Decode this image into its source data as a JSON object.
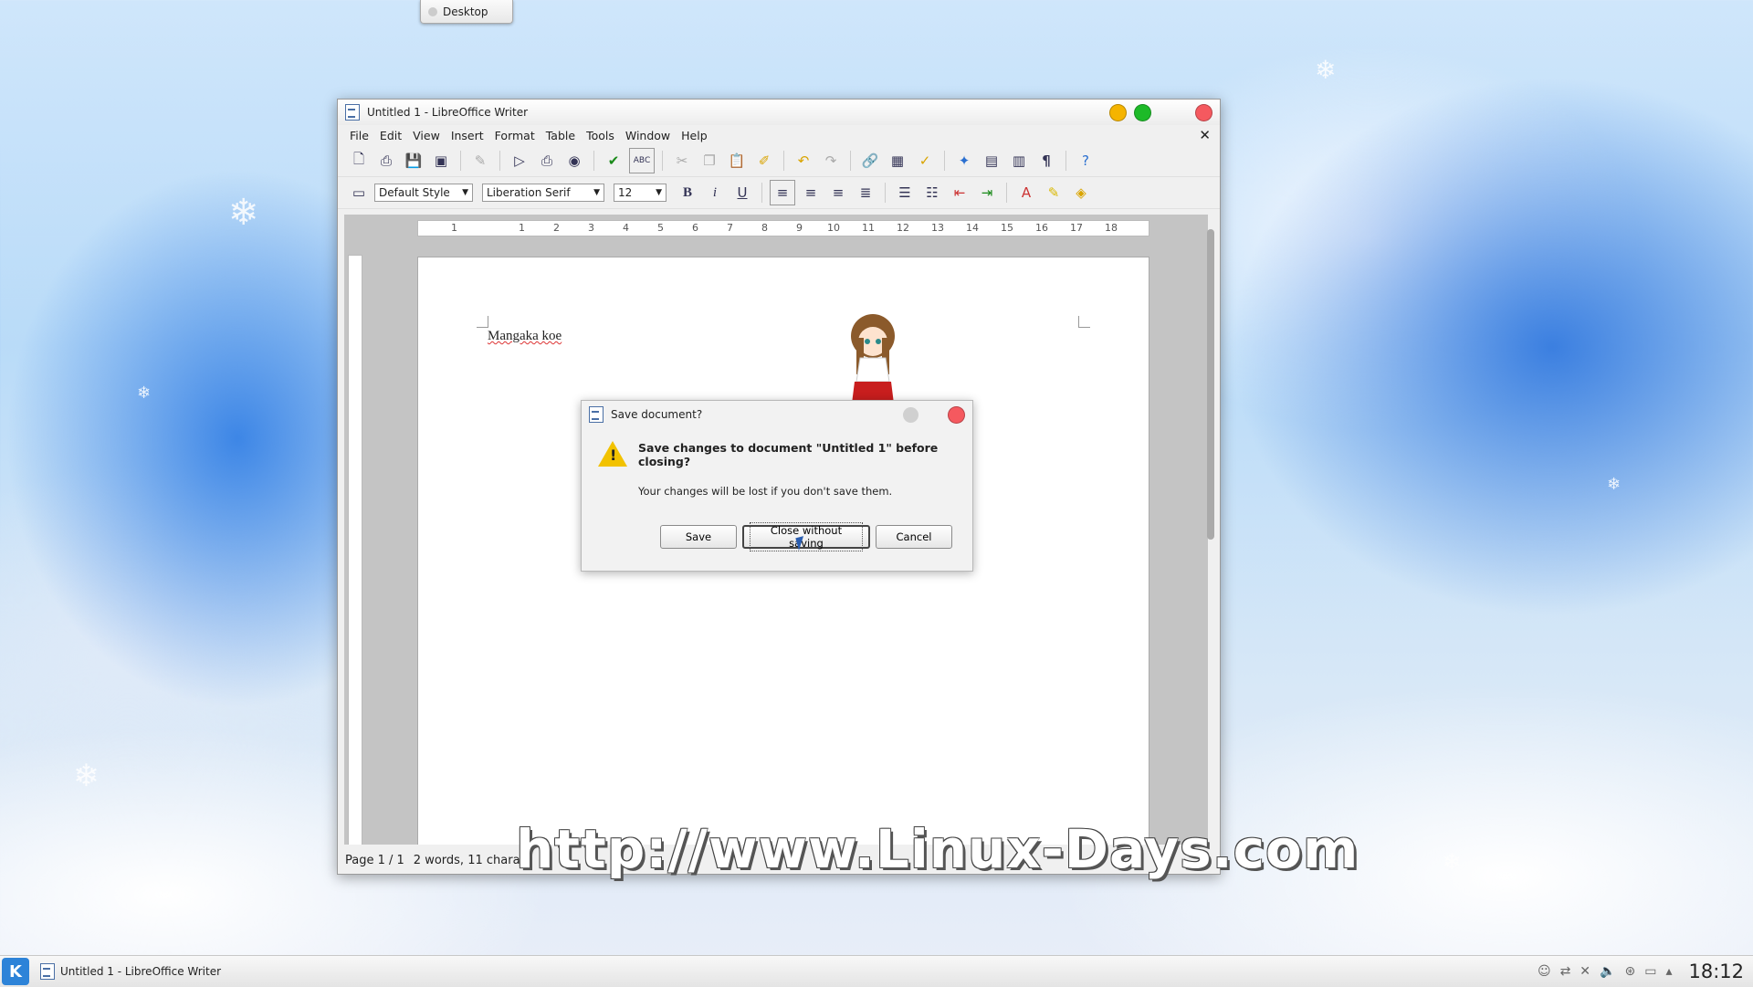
{
  "desktop": {
    "tab_label": "Desktop",
    "watermark": "http://www.Linux-Days.com"
  },
  "window": {
    "title": "Untitled 1 - LibreOffice Writer",
    "menu": [
      "File",
      "Edit",
      "View",
      "Insert",
      "Format",
      "Table",
      "Tools",
      "Window",
      "Help"
    ],
    "toolbar_icons": [
      "new-icon",
      "print-icon",
      "save-icon",
      "save-as-icon",
      "edit-icon",
      "pdf-icon",
      "print-direct-icon",
      "print-preview-icon",
      "spellcheck-icon",
      "autospell-icon",
      "cut-icon",
      "copy-icon",
      "paste-icon",
      "clone-icon",
      "undo-icon",
      "redo-icon",
      "hyperlink-icon",
      "table-icon",
      "draw-icon",
      "navigator-icon",
      "gallery-icon",
      "datasource-icon",
      "formatting-marks-icon",
      "help-icon"
    ],
    "format": {
      "style": "Default Style",
      "font": "Liberation Serif",
      "size": "12"
    },
    "ruler_numbers": [
      "1",
      "1",
      "2",
      "3",
      "4",
      "5",
      "6",
      "7",
      "8",
      "9",
      "10",
      "11",
      "12",
      "13",
      "14",
      "15",
      "16",
      "17",
      "18"
    ],
    "document_text": "Mangaka koe",
    "status": {
      "page": "Page 1 / 1",
      "words": "2 words, 11 charac"
    }
  },
  "dialog": {
    "title": "Save document?",
    "heading": "Save changes to document \"Untitled 1\" before closing?",
    "message": "Your changes will be lost if you don't save them.",
    "buttons": {
      "save": "Save",
      "close_without_saving": "Close without saving",
      "cancel": "Cancel"
    }
  },
  "taskbar": {
    "task_label": "Untitled 1 - LibreOffice Writer",
    "clock": "18:12",
    "start_label": "K"
  },
  "colors": {
    "accent": "#2d83d8",
    "close": "#f5595f",
    "minimize": "#f5b400",
    "maximize": "#1dba28"
  }
}
